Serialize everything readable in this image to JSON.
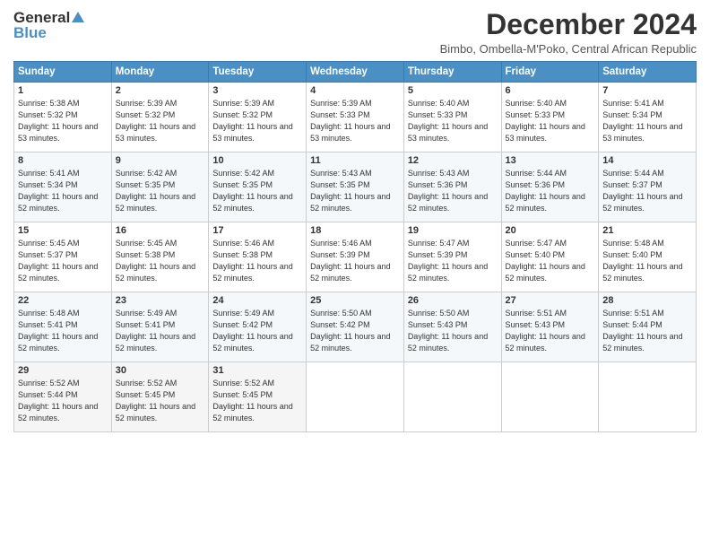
{
  "logo": {
    "line1": "General",
    "line2": "Blue"
  },
  "title": "December 2024",
  "subtitle": "Bimbo, Ombella-M'Poko, Central African Republic",
  "days_header": [
    "Sunday",
    "Monday",
    "Tuesday",
    "Wednesday",
    "Thursday",
    "Friday",
    "Saturday"
  ],
  "weeks": [
    [
      {
        "day": 1,
        "sunrise": "5:38 AM",
        "sunset": "5:32 PM",
        "daylight": "11 hours and 53 minutes"
      },
      {
        "day": 2,
        "sunrise": "5:39 AM",
        "sunset": "5:32 PM",
        "daylight": "11 hours and 53 minutes"
      },
      {
        "day": 3,
        "sunrise": "5:39 AM",
        "sunset": "5:32 PM",
        "daylight": "11 hours and 53 minutes"
      },
      {
        "day": 4,
        "sunrise": "5:39 AM",
        "sunset": "5:33 PM",
        "daylight": "11 hours and 53 minutes"
      },
      {
        "day": 5,
        "sunrise": "5:40 AM",
        "sunset": "5:33 PM",
        "daylight": "11 hours and 53 minutes"
      },
      {
        "day": 6,
        "sunrise": "5:40 AM",
        "sunset": "5:33 PM",
        "daylight": "11 hours and 53 minutes"
      },
      {
        "day": 7,
        "sunrise": "5:41 AM",
        "sunset": "5:34 PM",
        "daylight": "11 hours and 53 minutes"
      }
    ],
    [
      {
        "day": 8,
        "sunrise": "5:41 AM",
        "sunset": "5:34 PM",
        "daylight": "11 hours and 52 minutes"
      },
      {
        "day": 9,
        "sunrise": "5:42 AM",
        "sunset": "5:35 PM",
        "daylight": "11 hours and 52 minutes"
      },
      {
        "day": 10,
        "sunrise": "5:42 AM",
        "sunset": "5:35 PM",
        "daylight": "11 hours and 52 minutes"
      },
      {
        "day": 11,
        "sunrise": "5:43 AM",
        "sunset": "5:35 PM",
        "daylight": "11 hours and 52 minutes"
      },
      {
        "day": 12,
        "sunrise": "5:43 AM",
        "sunset": "5:36 PM",
        "daylight": "11 hours and 52 minutes"
      },
      {
        "day": 13,
        "sunrise": "5:44 AM",
        "sunset": "5:36 PM",
        "daylight": "11 hours and 52 minutes"
      },
      {
        "day": 14,
        "sunrise": "5:44 AM",
        "sunset": "5:37 PM",
        "daylight": "11 hours and 52 minutes"
      }
    ],
    [
      {
        "day": 15,
        "sunrise": "5:45 AM",
        "sunset": "5:37 PM",
        "daylight": "11 hours and 52 minutes"
      },
      {
        "day": 16,
        "sunrise": "5:45 AM",
        "sunset": "5:38 PM",
        "daylight": "11 hours and 52 minutes"
      },
      {
        "day": 17,
        "sunrise": "5:46 AM",
        "sunset": "5:38 PM",
        "daylight": "11 hours and 52 minutes"
      },
      {
        "day": 18,
        "sunrise": "5:46 AM",
        "sunset": "5:39 PM",
        "daylight": "11 hours and 52 minutes"
      },
      {
        "day": 19,
        "sunrise": "5:47 AM",
        "sunset": "5:39 PM",
        "daylight": "11 hours and 52 minutes"
      },
      {
        "day": 20,
        "sunrise": "5:47 AM",
        "sunset": "5:40 PM",
        "daylight": "11 hours and 52 minutes"
      },
      {
        "day": 21,
        "sunrise": "5:48 AM",
        "sunset": "5:40 PM",
        "daylight": "11 hours and 52 minutes"
      }
    ],
    [
      {
        "day": 22,
        "sunrise": "5:48 AM",
        "sunset": "5:41 PM",
        "daylight": "11 hours and 52 minutes"
      },
      {
        "day": 23,
        "sunrise": "5:49 AM",
        "sunset": "5:41 PM",
        "daylight": "11 hours and 52 minutes"
      },
      {
        "day": 24,
        "sunrise": "5:49 AM",
        "sunset": "5:42 PM",
        "daylight": "11 hours and 52 minutes"
      },
      {
        "day": 25,
        "sunrise": "5:50 AM",
        "sunset": "5:42 PM",
        "daylight": "11 hours and 52 minutes"
      },
      {
        "day": 26,
        "sunrise": "5:50 AM",
        "sunset": "5:43 PM",
        "daylight": "11 hours and 52 minutes"
      },
      {
        "day": 27,
        "sunrise": "5:51 AM",
        "sunset": "5:43 PM",
        "daylight": "11 hours and 52 minutes"
      },
      {
        "day": 28,
        "sunrise": "5:51 AM",
        "sunset": "5:44 PM",
        "daylight": "11 hours and 52 minutes"
      }
    ],
    [
      {
        "day": 29,
        "sunrise": "5:52 AM",
        "sunset": "5:44 PM",
        "daylight": "11 hours and 52 minutes"
      },
      {
        "day": 30,
        "sunrise": "5:52 AM",
        "sunset": "5:45 PM",
        "daylight": "11 hours and 52 minutes"
      },
      {
        "day": 31,
        "sunrise": "5:52 AM",
        "sunset": "5:45 PM",
        "daylight": "11 hours and 52 minutes"
      },
      null,
      null,
      null,
      null
    ]
  ]
}
